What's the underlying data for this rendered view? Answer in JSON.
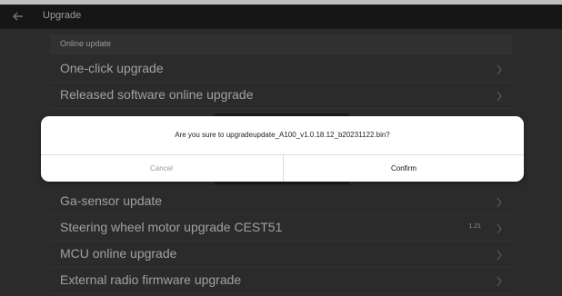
{
  "header": {
    "title": "Upgrade",
    "back_icon": "arrow-left-icon"
  },
  "section": {
    "label": "Online update"
  },
  "list": {
    "items": [
      {
        "label": "One-click upgrade",
        "badge": ""
      },
      {
        "label": "Released software online upgrade",
        "badge": ""
      },
      {
        "label": "Ga-sensor update",
        "badge": ""
      },
      {
        "label": "Steering wheel motor upgrade CEST51",
        "badge": "1.21"
      },
      {
        "label": "MCU online upgrade",
        "badge": ""
      },
      {
        "label": "External radio firmware upgrade",
        "badge": ""
      }
    ],
    "chevron_icon": "chevron-right-icon"
  },
  "dialog": {
    "message": "Are you sure to upgradeupdate_A100_v1.0.18.12_b20231122.bin?",
    "cancel_label": "Cancel",
    "confirm_label": "Confirm"
  },
  "colors": {
    "titlebar": "#1e1e1e",
    "background": "#3a3a3a",
    "dialog": "#ffffff"
  }
}
